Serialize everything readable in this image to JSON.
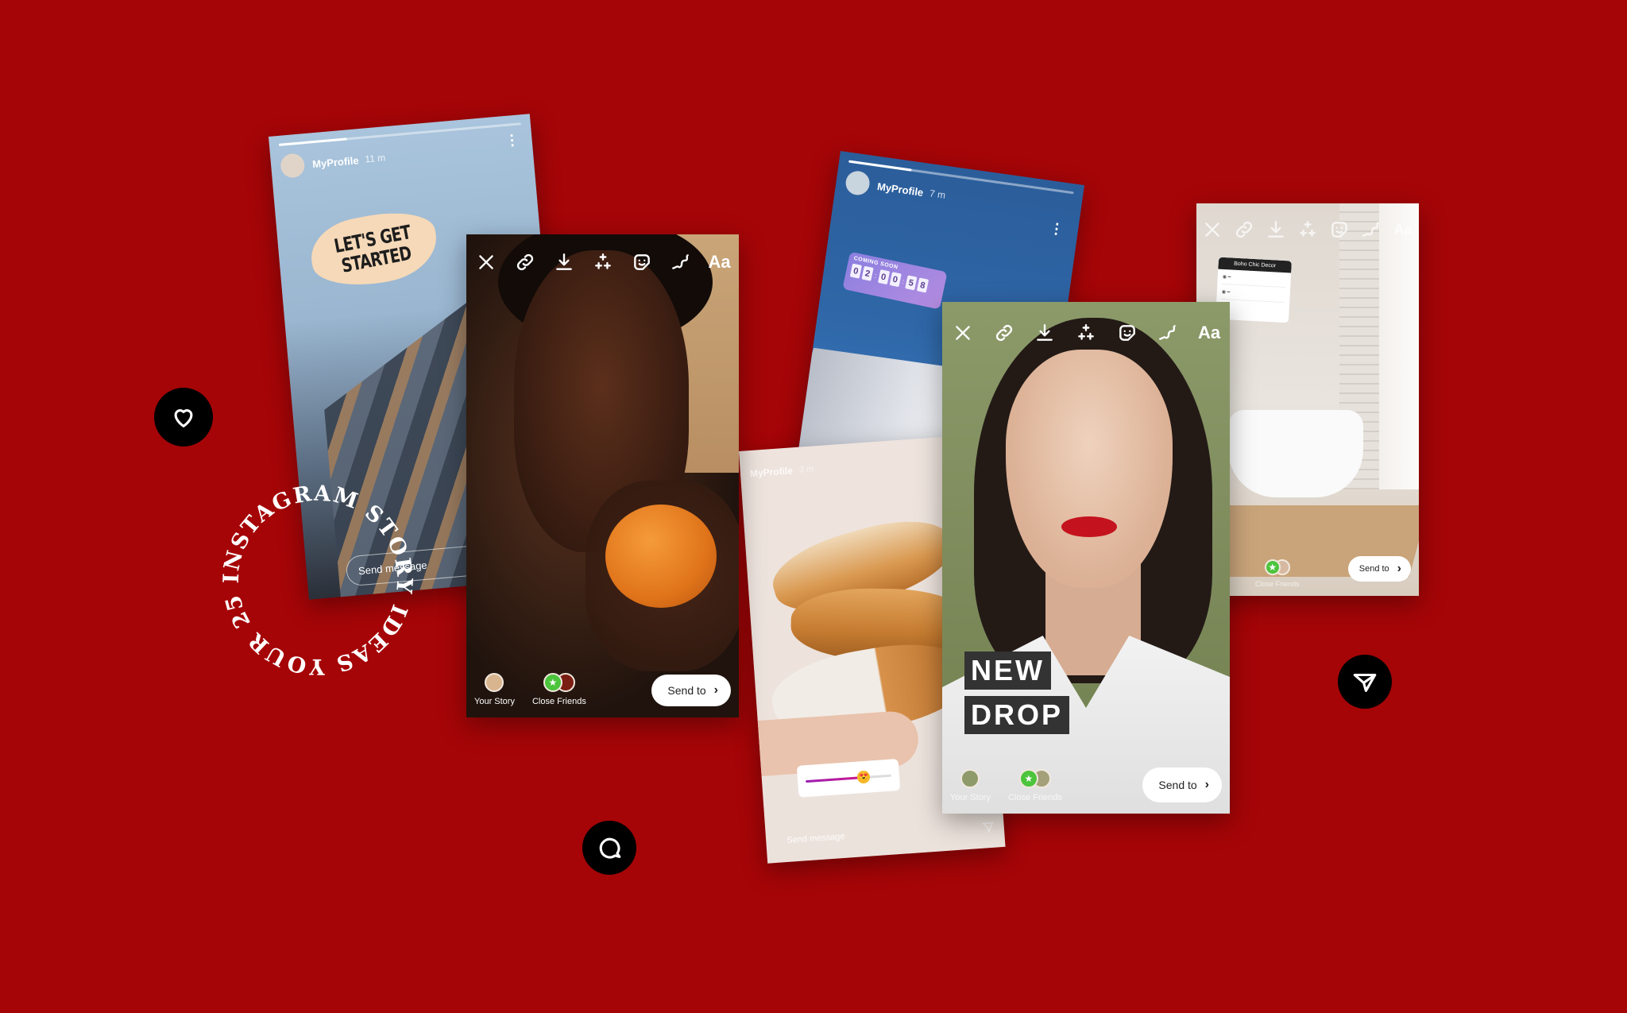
{
  "background_color": "#a50507",
  "headline_circle_text": "YOUR 25 INSTAGRAM STORY IDEAS FOR ",
  "editor_toolbar": {
    "icons": [
      "close-icon",
      "link-icon",
      "download-icon",
      "effects-sparkle-icon",
      "sticker-icon",
      "draw-icon",
      "text-icon"
    ],
    "text_tool_label": "Aa"
  },
  "share_targets": {
    "your_story": "Your Story",
    "close_friends": "Close Friends",
    "send_to": "Send to",
    "send_to_chevron": "›"
  },
  "cards": {
    "sky": {
      "profile": "MyProfile",
      "time": "11 m",
      "sticker_text_line1": "LET'S GET",
      "sticker_text_line2": "STARTED",
      "send_message_placeholder": "Send message",
      "progress_fraction": 0.28
    },
    "orange": {
      "your_story_color": "#d9b58f",
      "close_friends_color": "#7a1d12"
    },
    "coming_soon": {
      "profile": "MyProfile",
      "time": "7 m",
      "countdown_title": "COMING SOON",
      "countdown": [
        "0",
        "2",
        "0",
        "0",
        "5",
        "8"
      ],
      "progress_fraction": 0.28
    },
    "croissant": {
      "profile": "MyProfile",
      "time": "3 m",
      "slider_value_fraction": 0.68,
      "slider_emoji": "😍",
      "send_message_placeholder": "Send message"
    },
    "new_drop": {
      "line1": "NEW",
      "line2": "DROP",
      "your_story_color": "#8e9a6a",
      "close_friends_color": "#a3a07a"
    },
    "boho": {
      "poll_title": "Boho Chic Decor",
      "close_friends_color": "#d6b9a0"
    }
  },
  "floating_icons": [
    "heart-icon",
    "chat-bubble-icon",
    "send-paper-plane-icon"
  ],
  "star_glyph": "★",
  "more_glyph": "⋮"
}
